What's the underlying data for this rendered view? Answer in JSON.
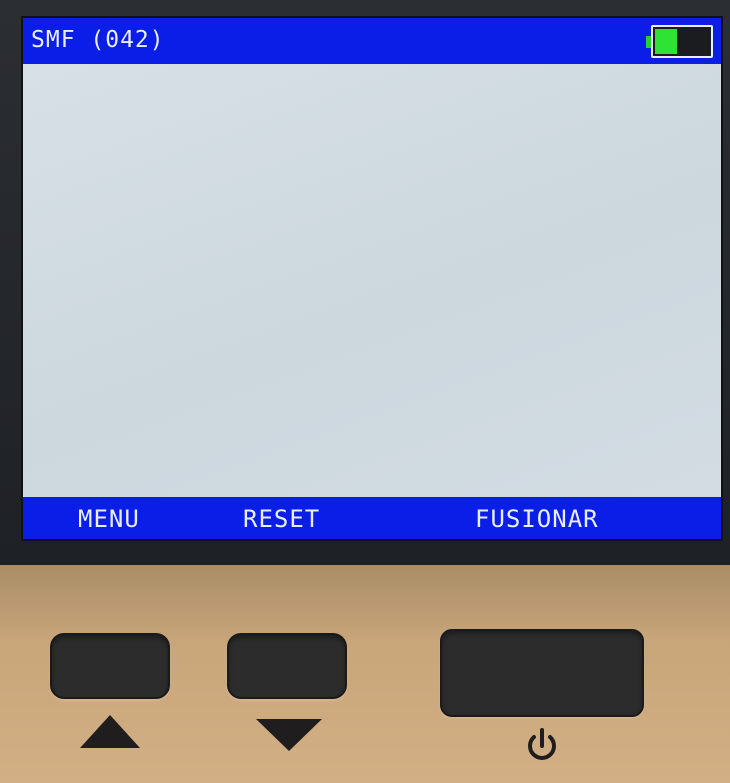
{
  "screen": {
    "title": "SMF (042)",
    "battery": {
      "level": 0.45,
      "color": "#2fe335"
    },
    "softkeys": {
      "left": "MENU",
      "center": "RESET",
      "right": "FUSIONAR"
    },
    "colors": {
      "bar": "#0a1ee8",
      "background": "#cfd9e0"
    }
  },
  "panel": {
    "buttons": [
      {
        "name": "up",
        "icon": "up-triangle-icon"
      },
      {
        "name": "down",
        "icon": "down-triangle-icon"
      },
      {
        "name": "power",
        "icon": "power-icon"
      }
    ]
  }
}
